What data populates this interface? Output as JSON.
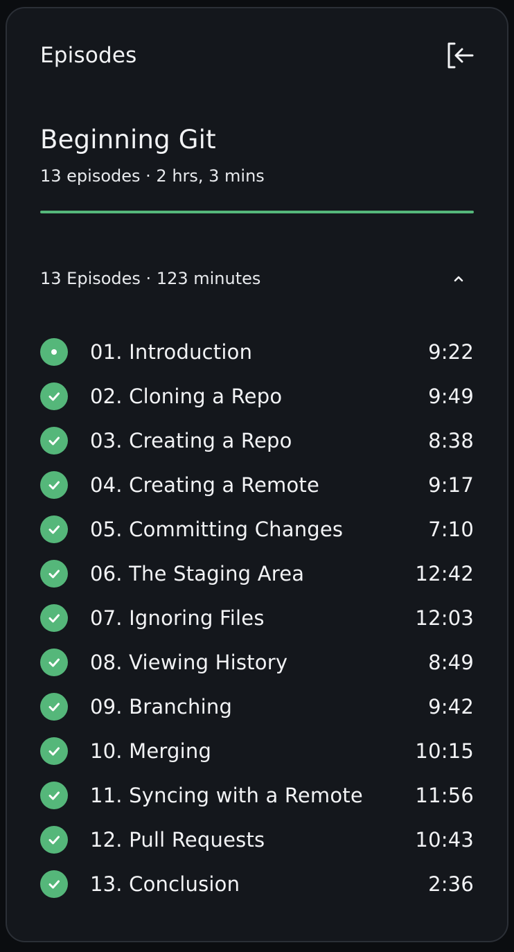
{
  "header": {
    "title": "Episodes",
    "collapse_icon": "sidebar-collapse-icon"
  },
  "course": {
    "title": "Beginning Git",
    "meta": "13 episodes · 2 hrs, 3 mins",
    "progress_percent": 100
  },
  "section": {
    "summary": "13 Episodes · 123 minutes",
    "expanded": true,
    "toggle_icon": "chevron-up-icon"
  },
  "colors": {
    "accent": "#55b77a",
    "background": "#14171c",
    "border": "#2b2f36",
    "text": "#f2f3f5"
  },
  "episodes": [
    {
      "title": "01. Introduction",
      "duration": "9:22",
      "status": "current"
    },
    {
      "title": "02. Cloning a Repo",
      "duration": "9:49",
      "status": "completed"
    },
    {
      "title": "03. Creating a Repo",
      "duration": "8:38",
      "status": "completed"
    },
    {
      "title": "04. Creating a Remote",
      "duration": "9:17",
      "status": "completed"
    },
    {
      "title": "05. Committing Changes",
      "duration": "7:10",
      "status": "completed"
    },
    {
      "title": "06. The Staging Area",
      "duration": "12:42",
      "status": "completed"
    },
    {
      "title": "07. Ignoring Files",
      "duration": "12:03",
      "status": "completed"
    },
    {
      "title": "08. Viewing History",
      "duration": "8:49",
      "status": "completed"
    },
    {
      "title": "09. Branching",
      "duration": "9:42",
      "status": "completed"
    },
    {
      "title": "10. Merging",
      "duration": "10:15",
      "status": "completed"
    },
    {
      "title": "11. Syncing with a Remote",
      "duration": "11:56",
      "status": "completed"
    },
    {
      "title": "12. Pull Requests",
      "duration": "10:43",
      "status": "completed"
    },
    {
      "title": "13. Conclusion",
      "duration": "2:36",
      "status": "completed"
    }
  ]
}
